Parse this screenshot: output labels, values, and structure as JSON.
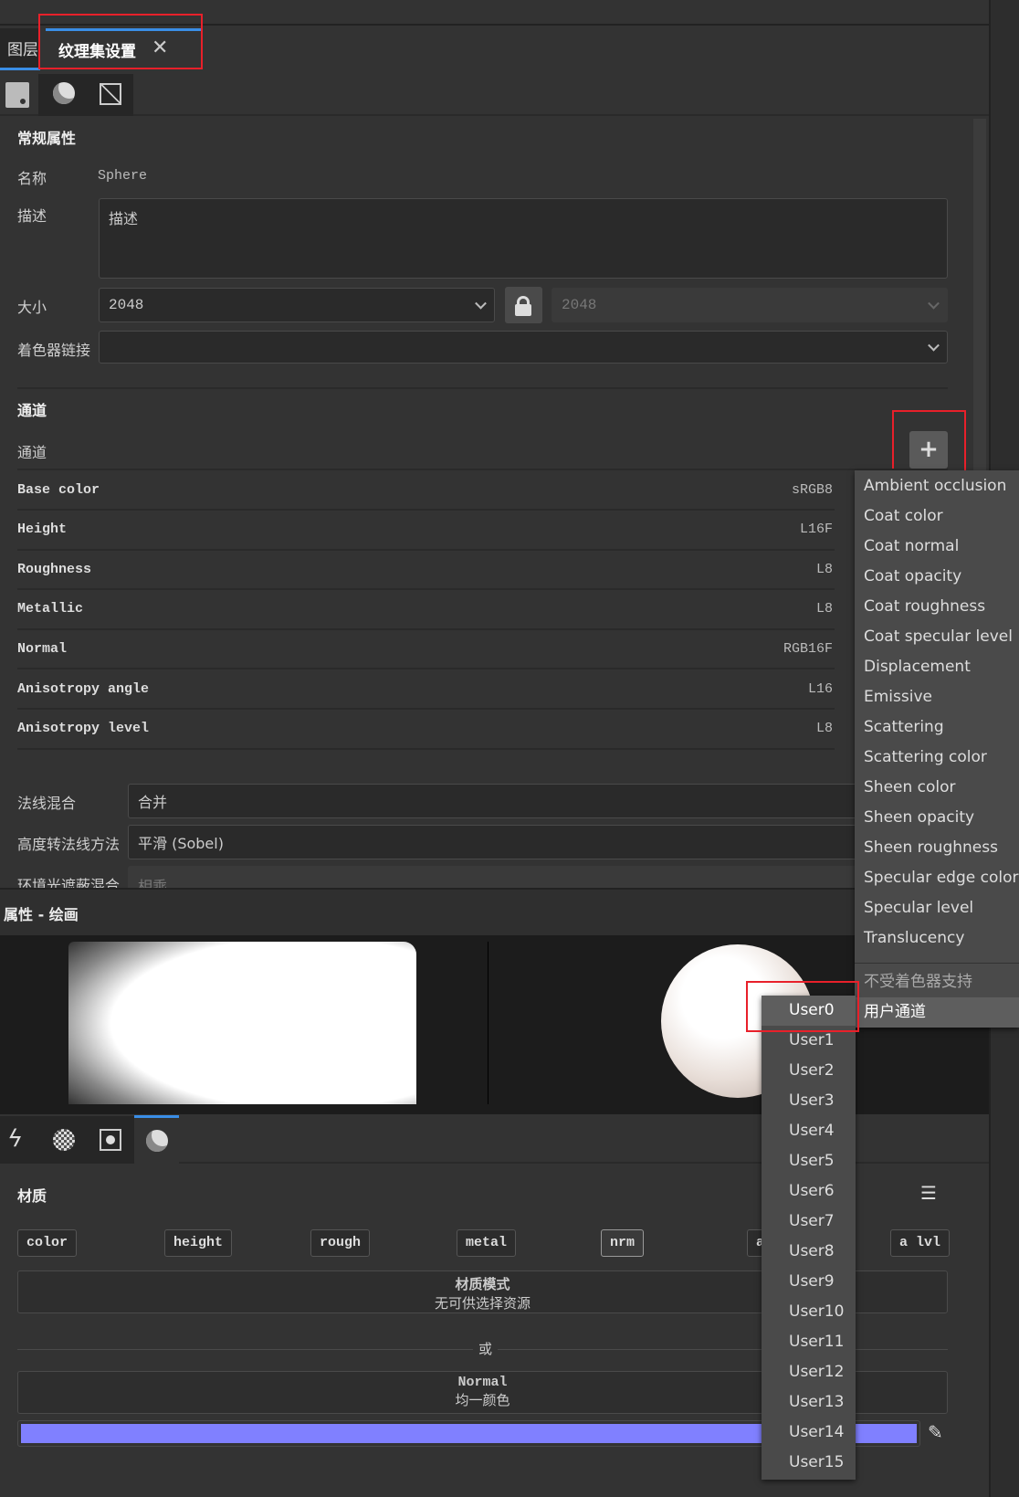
{
  "tabs": [
    {
      "label": "图层"
    },
    {
      "label": "纹理集设置",
      "active": true
    }
  ],
  "general": {
    "title": "常规属性",
    "name_label": "名称",
    "name_value": "Sphere",
    "desc_label": "描述",
    "desc_value": "描述",
    "size_label": "大小",
    "size_value": "2048",
    "size_value_locked": "2048",
    "shader_label": "着色器链接",
    "shader_value": ""
  },
  "channels": {
    "title": "通道",
    "label": "通道",
    "rows": [
      {
        "name": "Base color",
        "format": "sRGB8"
      },
      {
        "name": "Height",
        "format": "L16F"
      },
      {
        "name": "Roughness",
        "format": "L8"
      },
      {
        "name": "Metallic",
        "format": "L8"
      },
      {
        "name": "Normal",
        "format": "RGB16F"
      },
      {
        "name": "Anisotropy angle",
        "format": "L16"
      },
      {
        "name": "Anisotropy level",
        "format": "L8"
      }
    ]
  },
  "blend": {
    "normal_label": "法线混合",
    "normal_value": "合并",
    "h2n_label": "高度转法线方法",
    "h2n_value": "平滑 (Sobel)",
    "ao_label": "环境光遮蔽混合",
    "ao_value": "相乘"
  },
  "paint": {
    "title": "属性 - 绘画"
  },
  "material": {
    "title": "材质",
    "chips": [
      "color",
      "height",
      "rough",
      "metal",
      "nrm",
      "a",
      "a lvl"
    ],
    "mode_title": "材质模式",
    "mode_value": "无可供选择资源",
    "or": "或",
    "normal_title": "Normal",
    "normal_value": "均一颜色",
    "color": "#8080ff"
  },
  "menu": {
    "items": [
      "Ambient occlusion",
      "Coat color",
      "Coat normal",
      "Coat opacity",
      "Coat roughness",
      "Coat specular level",
      "Displacement",
      "Emissive",
      "Scattering",
      "Scattering color",
      "Sheen color",
      "Sheen opacity",
      "Sheen roughness",
      "Specular edge color",
      "Specular level",
      "Translucency"
    ],
    "unsupported": "不受着色器支持",
    "user_channels": "用户通道"
  },
  "submenu": {
    "items": [
      "User0",
      "User1",
      "User2",
      "User3",
      "User4",
      "User5",
      "User6",
      "User7",
      "User8",
      "User9",
      "User10",
      "User11",
      "User12",
      "User13",
      "User14",
      "User15"
    ]
  }
}
